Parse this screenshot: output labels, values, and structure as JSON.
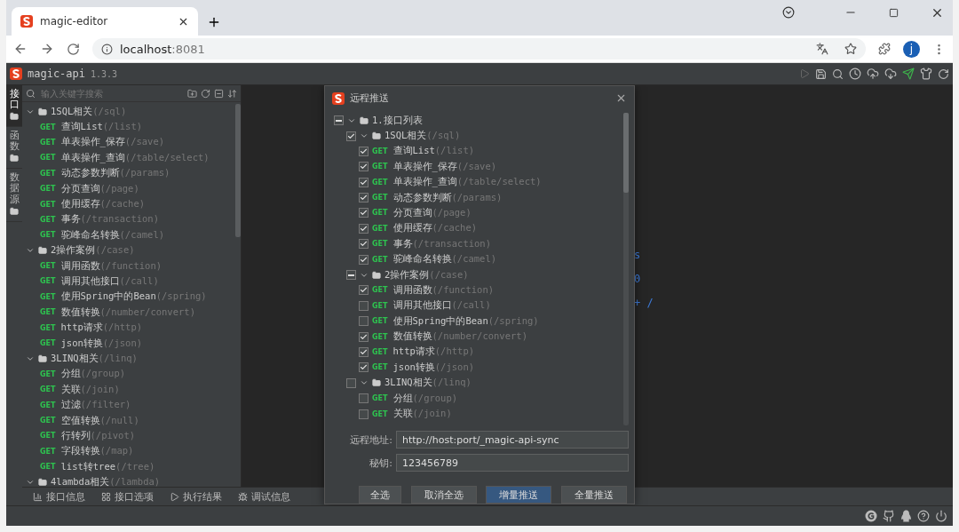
{
  "browser": {
    "tab_title": "magic-editor",
    "url_host": "localhost",
    "url_port": ":8081",
    "profile_initial": "j"
  },
  "app": {
    "name": "magic-api",
    "version": "1.3.3"
  },
  "side_tabs": [
    {
      "label": "接口",
      "selected": true
    },
    {
      "label": "函数",
      "selected": false
    },
    {
      "label": "数据源",
      "selected": false
    }
  ],
  "search": {
    "placeholder": "输入关键字搜索"
  },
  "tree": [
    {
      "name": "1SQL相关",
      "path": "(/sql)",
      "expanded": true,
      "children": [
        {
          "method": "GET",
          "name": "查询List",
          "path": "(/list)"
        },
        {
          "method": "GET",
          "name": "单表操作_保存",
          "path": "(/save)"
        },
        {
          "method": "GET",
          "name": "单表操作_查询",
          "path": "(/table/select)"
        },
        {
          "method": "GET",
          "name": "动态参数判断",
          "path": "(/params)"
        },
        {
          "method": "GET",
          "name": "分页查询",
          "path": "(/page)"
        },
        {
          "method": "GET",
          "name": "使用缓存",
          "path": "(/cache)"
        },
        {
          "method": "GET",
          "name": "事务",
          "path": "(/transaction)"
        },
        {
          "method": "GET",
          "name": "驼峰命名转换",
          "path": "(/camel)"
        }
      ]
    },
    {
      "name": "2操作案例",
      "path": "(/case)",
      "expanded": true,
      "children": [
        {
          "method": "GET",
          "name": "调用函数",
          "path": "(/function)"
        },
        {
          "method": "GET",
          "name": "调用其他接口",
          "path": "(/call)"
        },
        {
          "method": "GET",
          "name": "使用Spring中的Bean",
          "path": "(/spring)"
        },
        {
          "method": "GET",
          "name": "数值转换",
          "path": "(/number/convert)"
        },
        {
          "method": "GET",
          "name": "http请求",
          "path": "(/http)"
        },
        {
          "method": "GET",
          "name": "json转换",
          "path": "(/json)"
        }
      ]
    },
    {
      "name": "3LINQ相关",
      "path": "(/linq)",
      "expanded": true,
      "children": [
        {
          "method": "GET",
          "name": "分组",
          "path": "(/group)"
        },
        {
          "method": "GET",
          "name": "关联",
          "path": "(/join)"
        },
        {
          "method": "GET",
          "name": "过滤",
          "path": "(/filter)"
        },
        {
          "method": "GET",
          "name": "空值转换",
          "path": "(/null)"
        },
        {
          "method": "GET",
          "name": "行转列",
          "path": "(/pivot)"
        },
        {
          "method": "GET",
          "name": "字段转换",
          "path": "(/map)"
        },
        {
          "method": "GET",
          "name": "list转tree",
          "path": "(/tree)"
        }
      ]
    },
    {
      "name": "4lambda相关",
      "path": "(/lambda)",
      "expanded": true
    }
  ],
  "editor_lines": [
    "s",
    "0",
    "+ /"
  ],
  "bottom_tabs": [
    "接口信息",
    "接口选项",
    "执行结果",
    "调试信息"
  ],
  "dialog": {
    "title": "远程推送",
    "root": {
      "name": "1.接口列表",
      "checked": false,
      "partial": true,
      "expanded": true
    },
    "groups": [
      {
        "name": "1SQL相关",
        "path": "(/sql)",
        "checked": true,
        "expanded": true,
        "children": [
          {
            "method": "GET",
            "name": "查询List",
            "path": "(/list)",
            "checked": true
          },
          {
            "method": "GET",
            "name": "单表操作_保存",
            "path": "(/save)",
            "checked": true
          },
          {
            "method": "GET",
            "name": "单表操作_查询",
            "path": "(/table/select)",
            "checked": true
          },
          {
            "method": "GET",
            "name": "动态参数判断",
            "path": "(/params)",
            "checked": true
          },
          {
            "method": "GET",
            "name": "分页查询",
            "path": "(/page)",
            "checked": true
          },
          {
            "method": "GET",
            "name": "使用缓存",
            "path": "(/cache)",
            "checked": true
          },
          {
            "method": "GET",
            "name": "事务",
            "path": "(/transaction)",
            "checked": true
          },
          {
            "method": "GET",
            "name": "驼峰命名转换",
            "path": "(/camel)",
            "checked": true
          }
        ]
      },
      {
        "name": "2操作案例",
        "path": "(/case)",
        "checked": false,
        "partial": true,
        "expanded": true,
        "children": [
          {
            "method": "GET",
            "name": "调用函数",
            "path": "(/function)",
            "checked": true
          },
          {
            "method": "GET",
            "name": "调用其他接口",
            "path": "(/call)",
            "checked": false
          },
          {
            "method": "GET",
            "name": "使用Spring中的Bean",
            "path": "(/spring)",
            "checked": false
          },
          {
            "method": "GET",
            "name": "数值转换",
            "path": "(/number/convert)",
            "checked": true
          },
          {
            "method": "GET",
            "name": "http请求",
            "path": "(/http)",
            "checked": true
          },
          {
            "method": "GET",
            "name": "json转换",
            "path": "(/json)",
            "checked": true
          }
        ]
      },
      {
        "name": "3LINQ相关",
        "path": "(/linq)",
        "checked": false,
        "partial": false,
        "expanded": true,
        "children": [
          {
            "method": "GET",
            "name": "分组",
            "path": "(/group)",
            "checked": false
          },
          {
            "method": "GET",
            "name": "关联",
            "path": "(/join)",
            "checked": false
          }
        ]
      }
    ],
    "fields": [
      {
        "label": "远程地址:",
        "value": "http://host:port/_magic-api-sync"
      },
      {
        "label": "秘钥:",
        "value": "123456789"
      }
    ],
    "buttons": [
      {
        "label": "全选",
        "primary": false
      },
      {
        "label": "取消全选",
        "primary": false
      },
      {
        "label": "增量推送",
        "primary": true
      },
      {
        "label": "全量推送",
        "primary": false
      }
    ]
  }
}
